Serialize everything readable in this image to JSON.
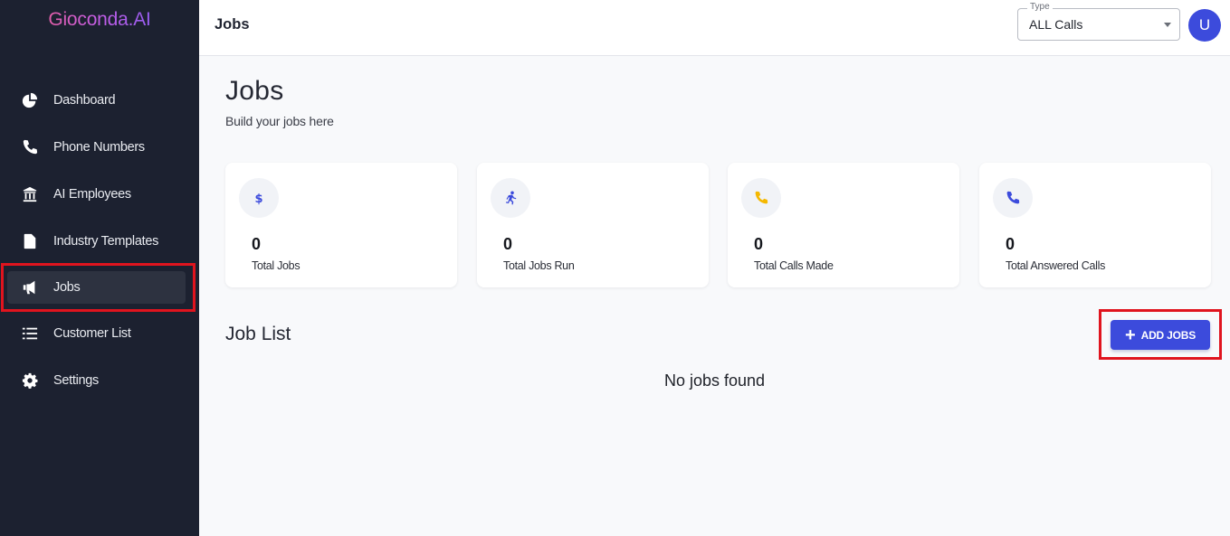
{
  "app": {
    "logo": "Gioconda.AI"
  },
  "sidebar": {
    "items": [
      {
        "label": "Dashboard",
        "icon": "pie-chart-icon",
        "active": false
      },
      {
        "label": "Phone Numbers",
        "icon": "phone-icon",
        "active": false
      },
      {
        "label": "AI Employees",
        "icon": "building-icon",
        "active": false
      },
      {
        "label": "Industry Templates",
        "icon": "file-icon",
        "active": false
      },
      {
        "label": "Jobs",
        "icon": "megaphone-icon",
        "active": true
      },
      {
        "label": "Customer List",
        "icon": "list-icon",
        "active": false
      },
      {
        "label": "Settings",
        "icon": "gear-icon",
        "active": false
      }
    ]
  },
  "header": {
    "title": "Jobs",
    "type_select": {
      "legend": "Type",
      "value": "ALL Calls"
    },
    "avatar_initial": "U"
  },
  "main": {
    "title": "Jobs",
    "subtitle": "Build your jobs here",
    "stats": [
      {
        "value": "0",
        "label": "Total Jobs",
        "icon": "dollar-icon",
        "color": "#3c4bdc"
      },
      {
        "value": "0",
        "label": "Total Jobs Run",
        "icon": "running-person-icon",
        "color": "#3c4bdc"
      },
      {
        "value": "0",
        "label": "Total Calls Made",
        "icon": "phone-icon",
        "color": "#f5b800"
      },
      {
        "value": "0",
        "label": "Total Answered Calls",
        "icon": "phone-icon",
        "color": "#3c4bdc"
      }
    ],
    "job_list": {
      "title": "Job List",
      "add_button_label": "ADD JOBS",
      "empty_message": "No jobs found"
    }
  },
  "colors": {
    "sidebar_bg": "#1c2130",
    "accent": "#3c4bdc",
    "highlight": "#e0141e"
  }
}
